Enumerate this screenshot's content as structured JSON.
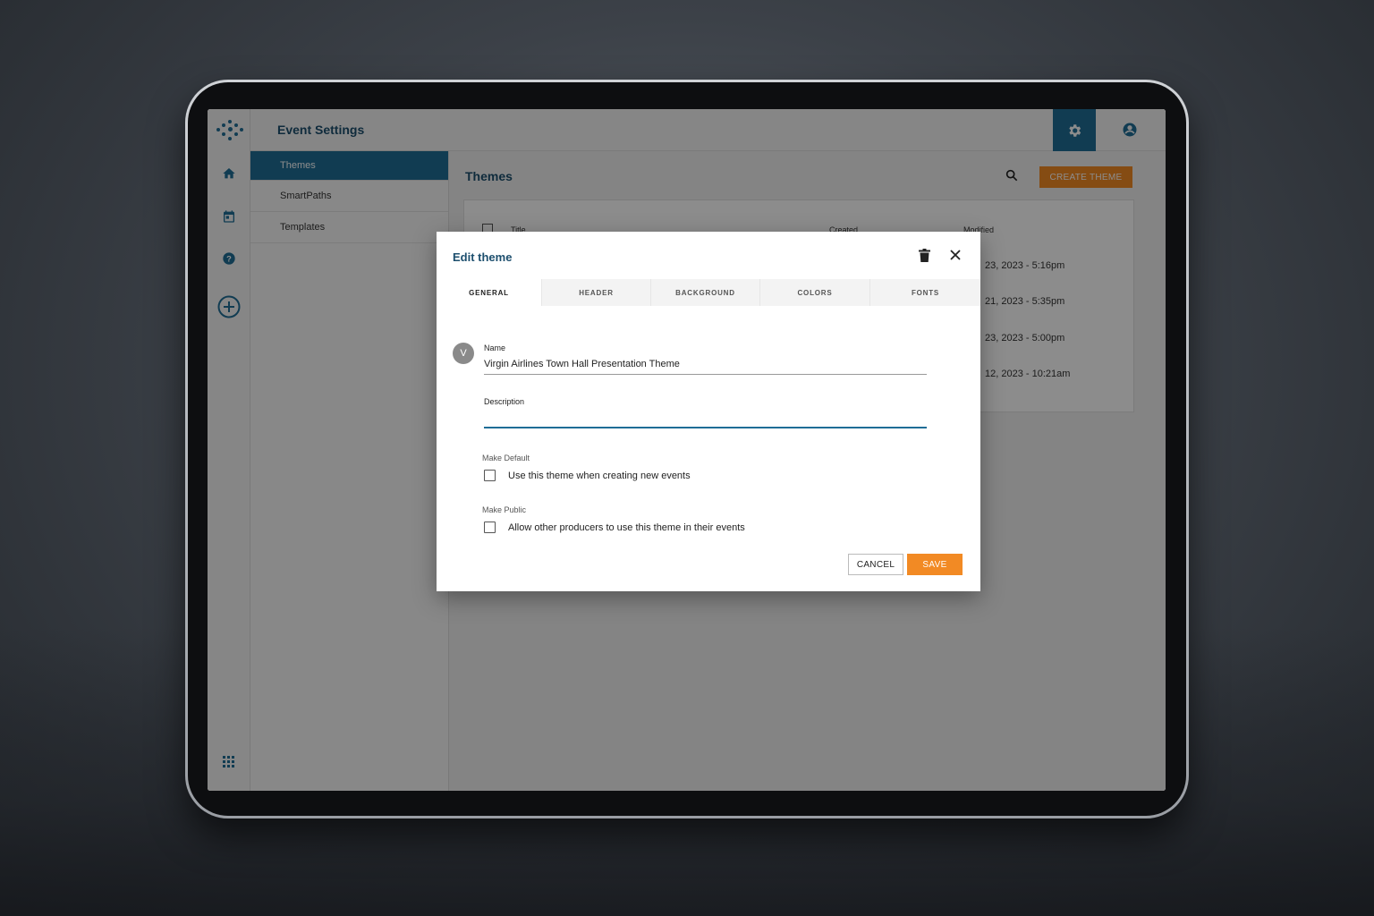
{
  "topbar": {
    "title": "Event Settings"
  },
  "subnav": {
    "items": [
      {
        "label": "Themes",
        "active": true
      },
      {
        "label": "SmartPaths",
        "active": false
      },
      {
        "label": "Templates",
        "active": false
      }
    ]
  },
  "main": {
    "heading": "Themes",
    "create_label": "CREATE THEME",
    "table": {
      "headers": [
        "Title",
        "Created",
        "Modified"
      ],
      "modified_dates": [
        "23, 2023 - 5:16pm",
        "21, 2023 - 5:35pm",
        "23, 2023 - 5:00pm",
        "12, 2023 - 10:21am"
      ]
    }
  },
  "dialog": {
    "title": "Edit theme",
    "tabs": [
      "GENERAL",
      "HEADER",
      "BACKGROUND",
      "COLORS",
      "FONTS"
    ],
    "active_tab": "GENERAL",
    "avatar_letter": "V",
    "name_label": "Name",
    "name_value": "Virgin Airlines Town Hall Presentation Theme",
    "description_label": "Description",
    "description_value": "",
    "make_default_label": "Make Default",
    "make_default_text": "Use this theme when creating new events",
    "make_default_checked": false,
    "make_public_label": "Make Public",
    "make_public_text": "Allow other producers to use this theme in their events",
    "make_public_checked": false,
    "cancel_label": "CANCEL",
    "save_label": "SAVE"
  },
  "colors": {
    "primary": "#1f6d96",
    "accent": "#f28a24",
    "title": "#1d4f6e"
  }
}
